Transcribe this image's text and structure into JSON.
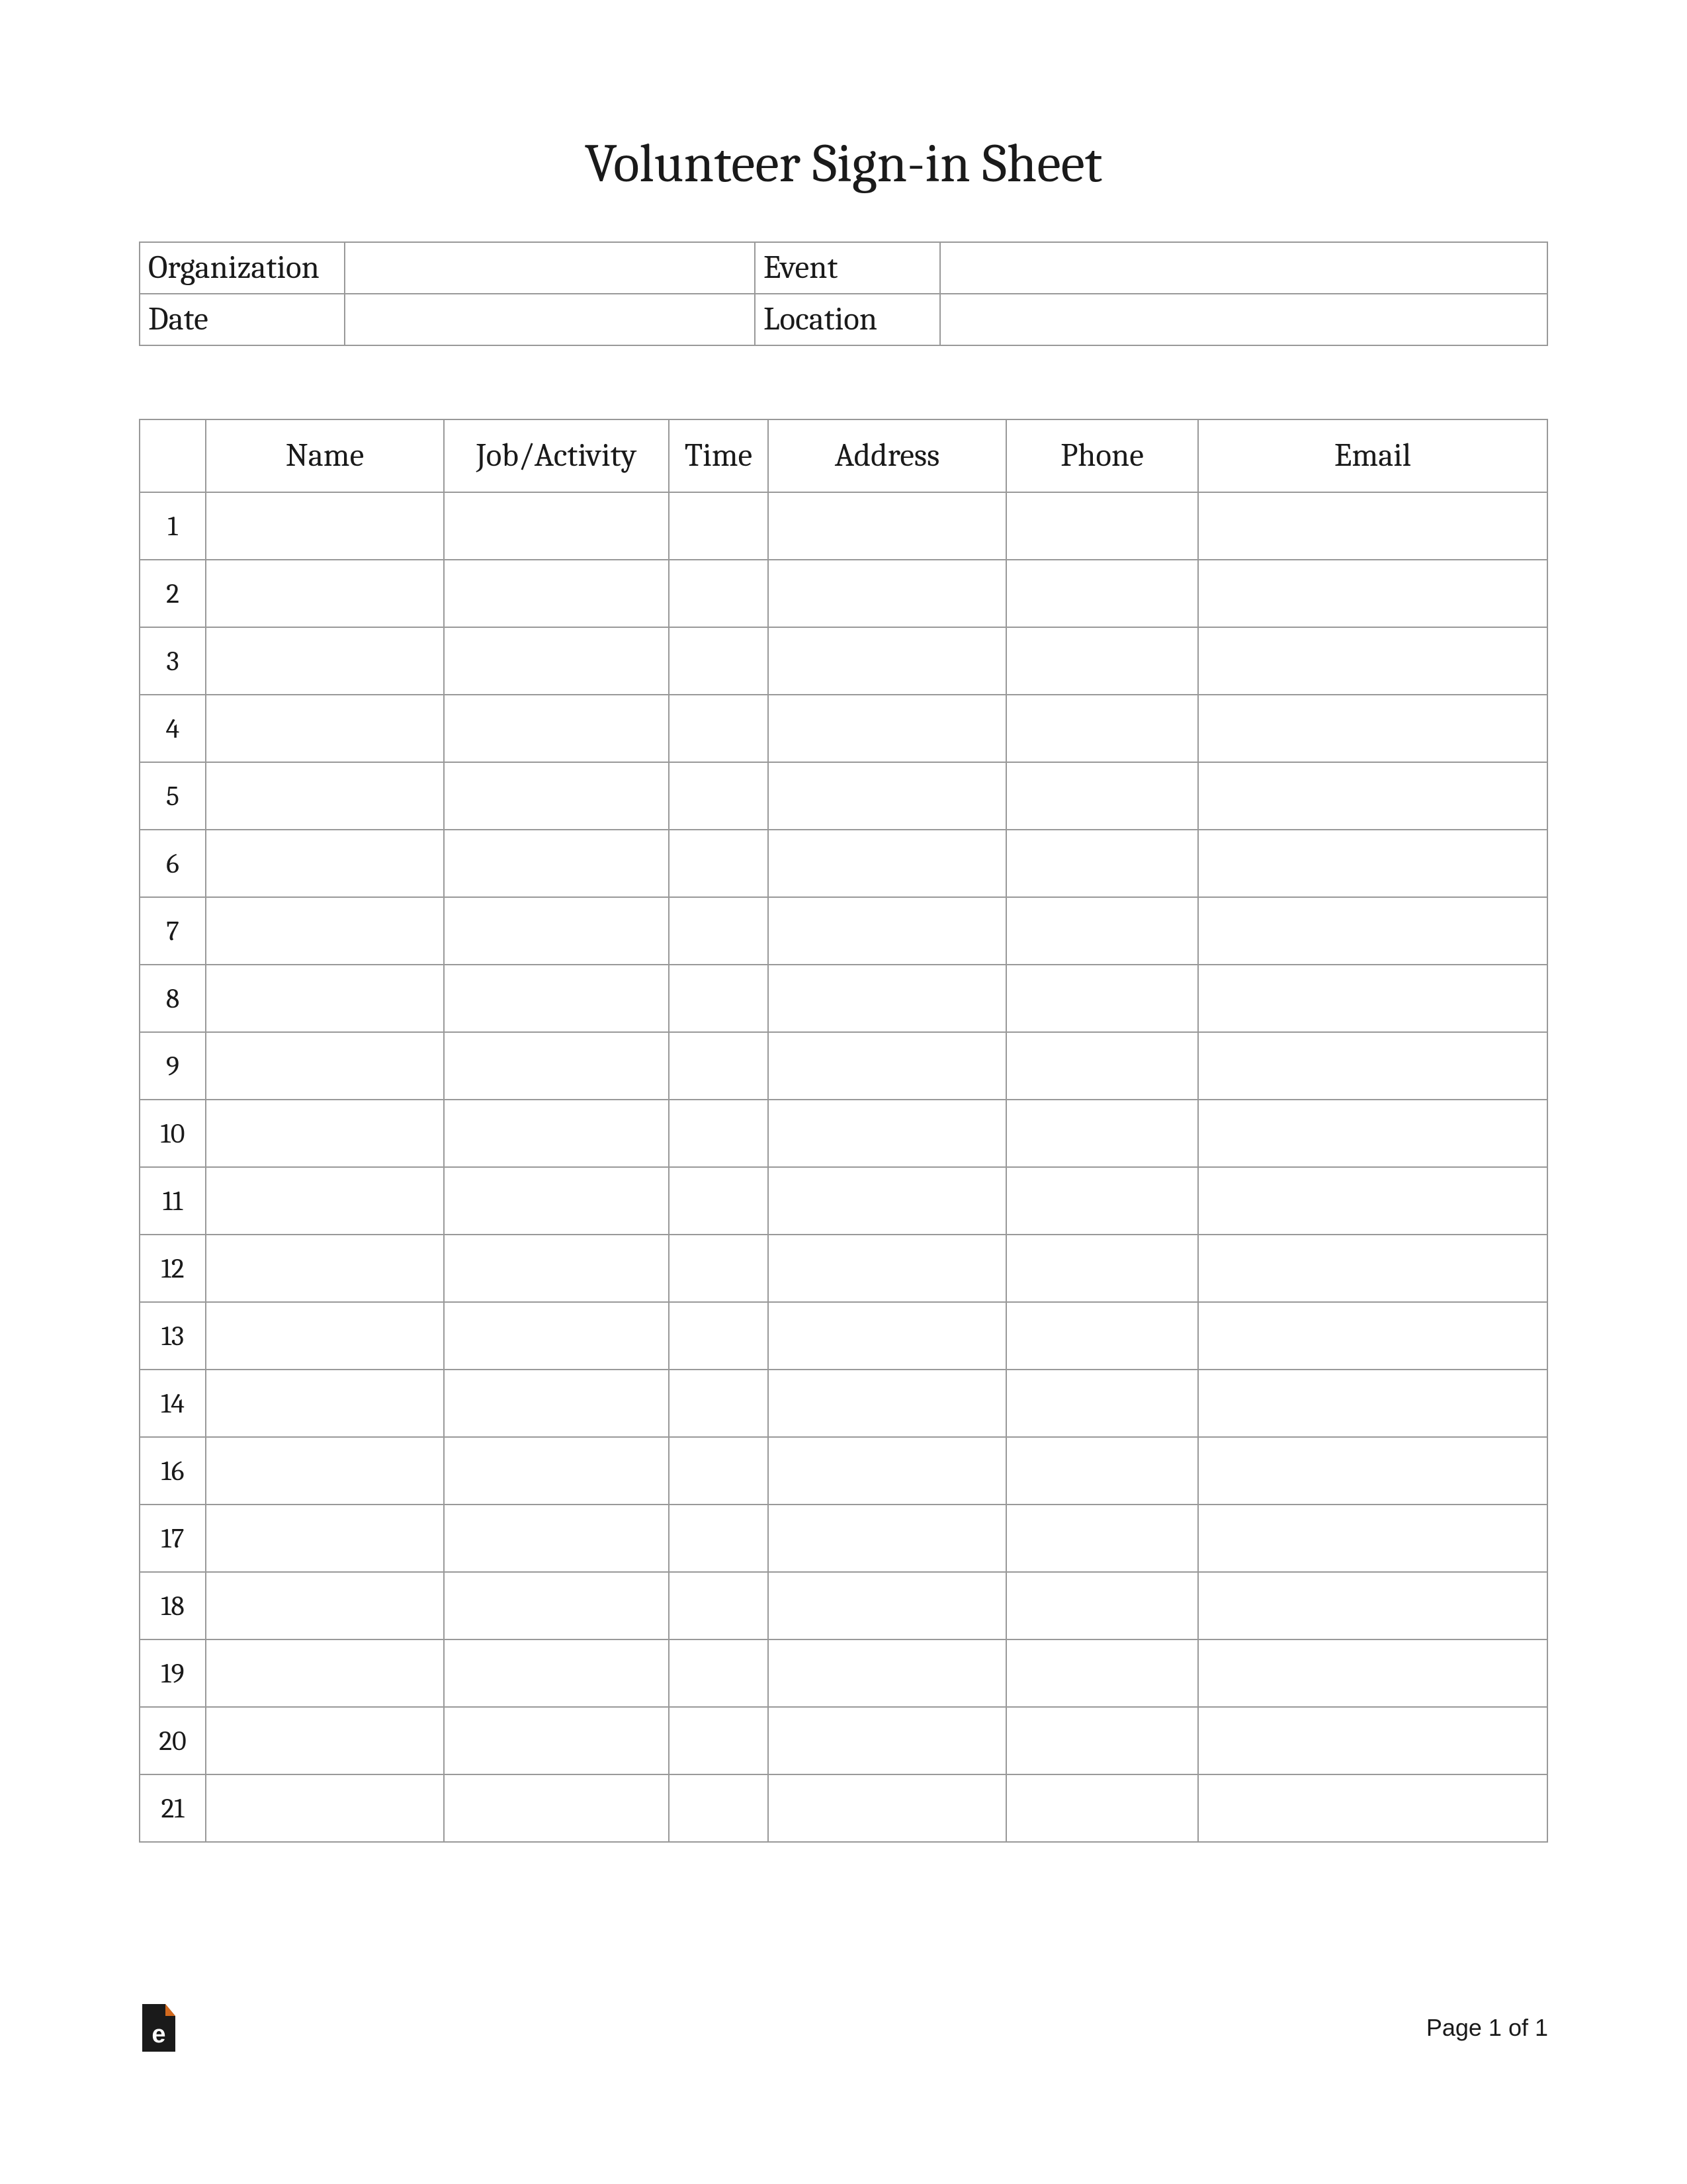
{
  "title": "Volunteer Sign-in Sheet",
  "info": {
    "organization_label": "Organization",
    "organization_value": "",
    "event_label": "Event",
    "event_value": "",
    "date_label": "Date",
    "date_value": "",
    "location_label": "Location",
    "location_value": ""
  },
  "columns": {
    "num": "",
    "name": "Name",
    "job": "Job/Activity",
    "time": "Time",
    "address": "Address",
    "phone": "Phone",
    "email": "Email"
  },
  "rows": [
    {
      "num": "1",
      "name": "",
      "job": "",
      "time": "",
      "address": "",
      "phone": "",
      "email": ""
    },
    {
      "num": "2",
      "name": "",
      "job": "",
      "time": "",
      "address": "",
      "phone": "",
      "email": ""
    },
    {
      "num": "3",
      "name": "",
      "job": "",
      "time": "",
      "address": "",
      "phone": "",
      "email": ""
    },
    {
      "num": "4",
      "name": "",
      "job": "",
      "time": "",
      "address": "",
      "phone": "",
      "email": ""
    },
    {
      "num": "5",
      "name": "",
      "job": "",
      "time": "",
      "address": "",
      "phone": "",
      "email": ""
    },
    {
      "num": "6",
      "name": "",
      "job": "",
      "time": "",
      "address": "",
      "phone": "",
      "email": ""
    },
    {
      "num": "7",
      "name": "",
      "job": "",
      "time": "",
      "address": "",
      "phone": "",
      "email": ""
    },
    {
      "num": "8",
      "name": "",
      "job": "",
      "time": "",
      "address": "",
      "phone": "",
      "email": ""
    },
    {
      "num": "9",
      "name": "",
      "job": "",
      "time": "",
      "address": "",
      "phone": "",
      "email": ""
    },
    {
      "num": "10",
      "name": "",
      "job": "",
      "time": "",
      "address": "",
      "phone": "",
      "email": ""
    },
    {
      "num": "11",
      "name": "",
      "job": "",
      "time": "",
      "address": "",
      "phone": "",
      "email": ""
    },
    {
      "num": "12",
      "name": "",
      "job": "",
      "time": "",
      "address": "",
      "phone": "",
      "email": ""
    },
    {
      "num": "13",
      "name": "",
      "job": "",
      "time": "",
      "address": "",
      "phone": "",
      "email": ""
    },
    {
      "num": "14",
      "name": "",
      "job": "",
      "time": "",
      "address": "",
      "phone": "",
      "email": ""
    },
    {
      "num": "16",
      "name": "",
      "job": "",
      "time": "",
      "address": "",
      "phone": "",
      "email": ""
    },
    {
      "num": "17",
      "name": "",
      "job": "",
      "time": "",
      "address": "",
      "phone": "",
      "email": ""
    },
    {
      "num": "18",
      "name": "",
      "job": "",
      "time": "",
      "address": "",
      "phone": "",
      "email": ""
    },
    {
      "num": "19",
      "name": "",
      "job": "",
      "time": "",
      "address": "",
      "phone": "",
      "email": ""
    },
    {
      "num": "20",
      "name": "",
      "job": "",
      "time": "",
      "address": "",
      "phone": "",
      "email": ""
    },
    {
      "num": "21",
      "name": "",
      "job": "",
      "time": "",
      "address": "",
      "phone": "",
      "email": ""
    }
  ],
  "footer": {
    "page_label": "Page 1 of 1"
  }
}
